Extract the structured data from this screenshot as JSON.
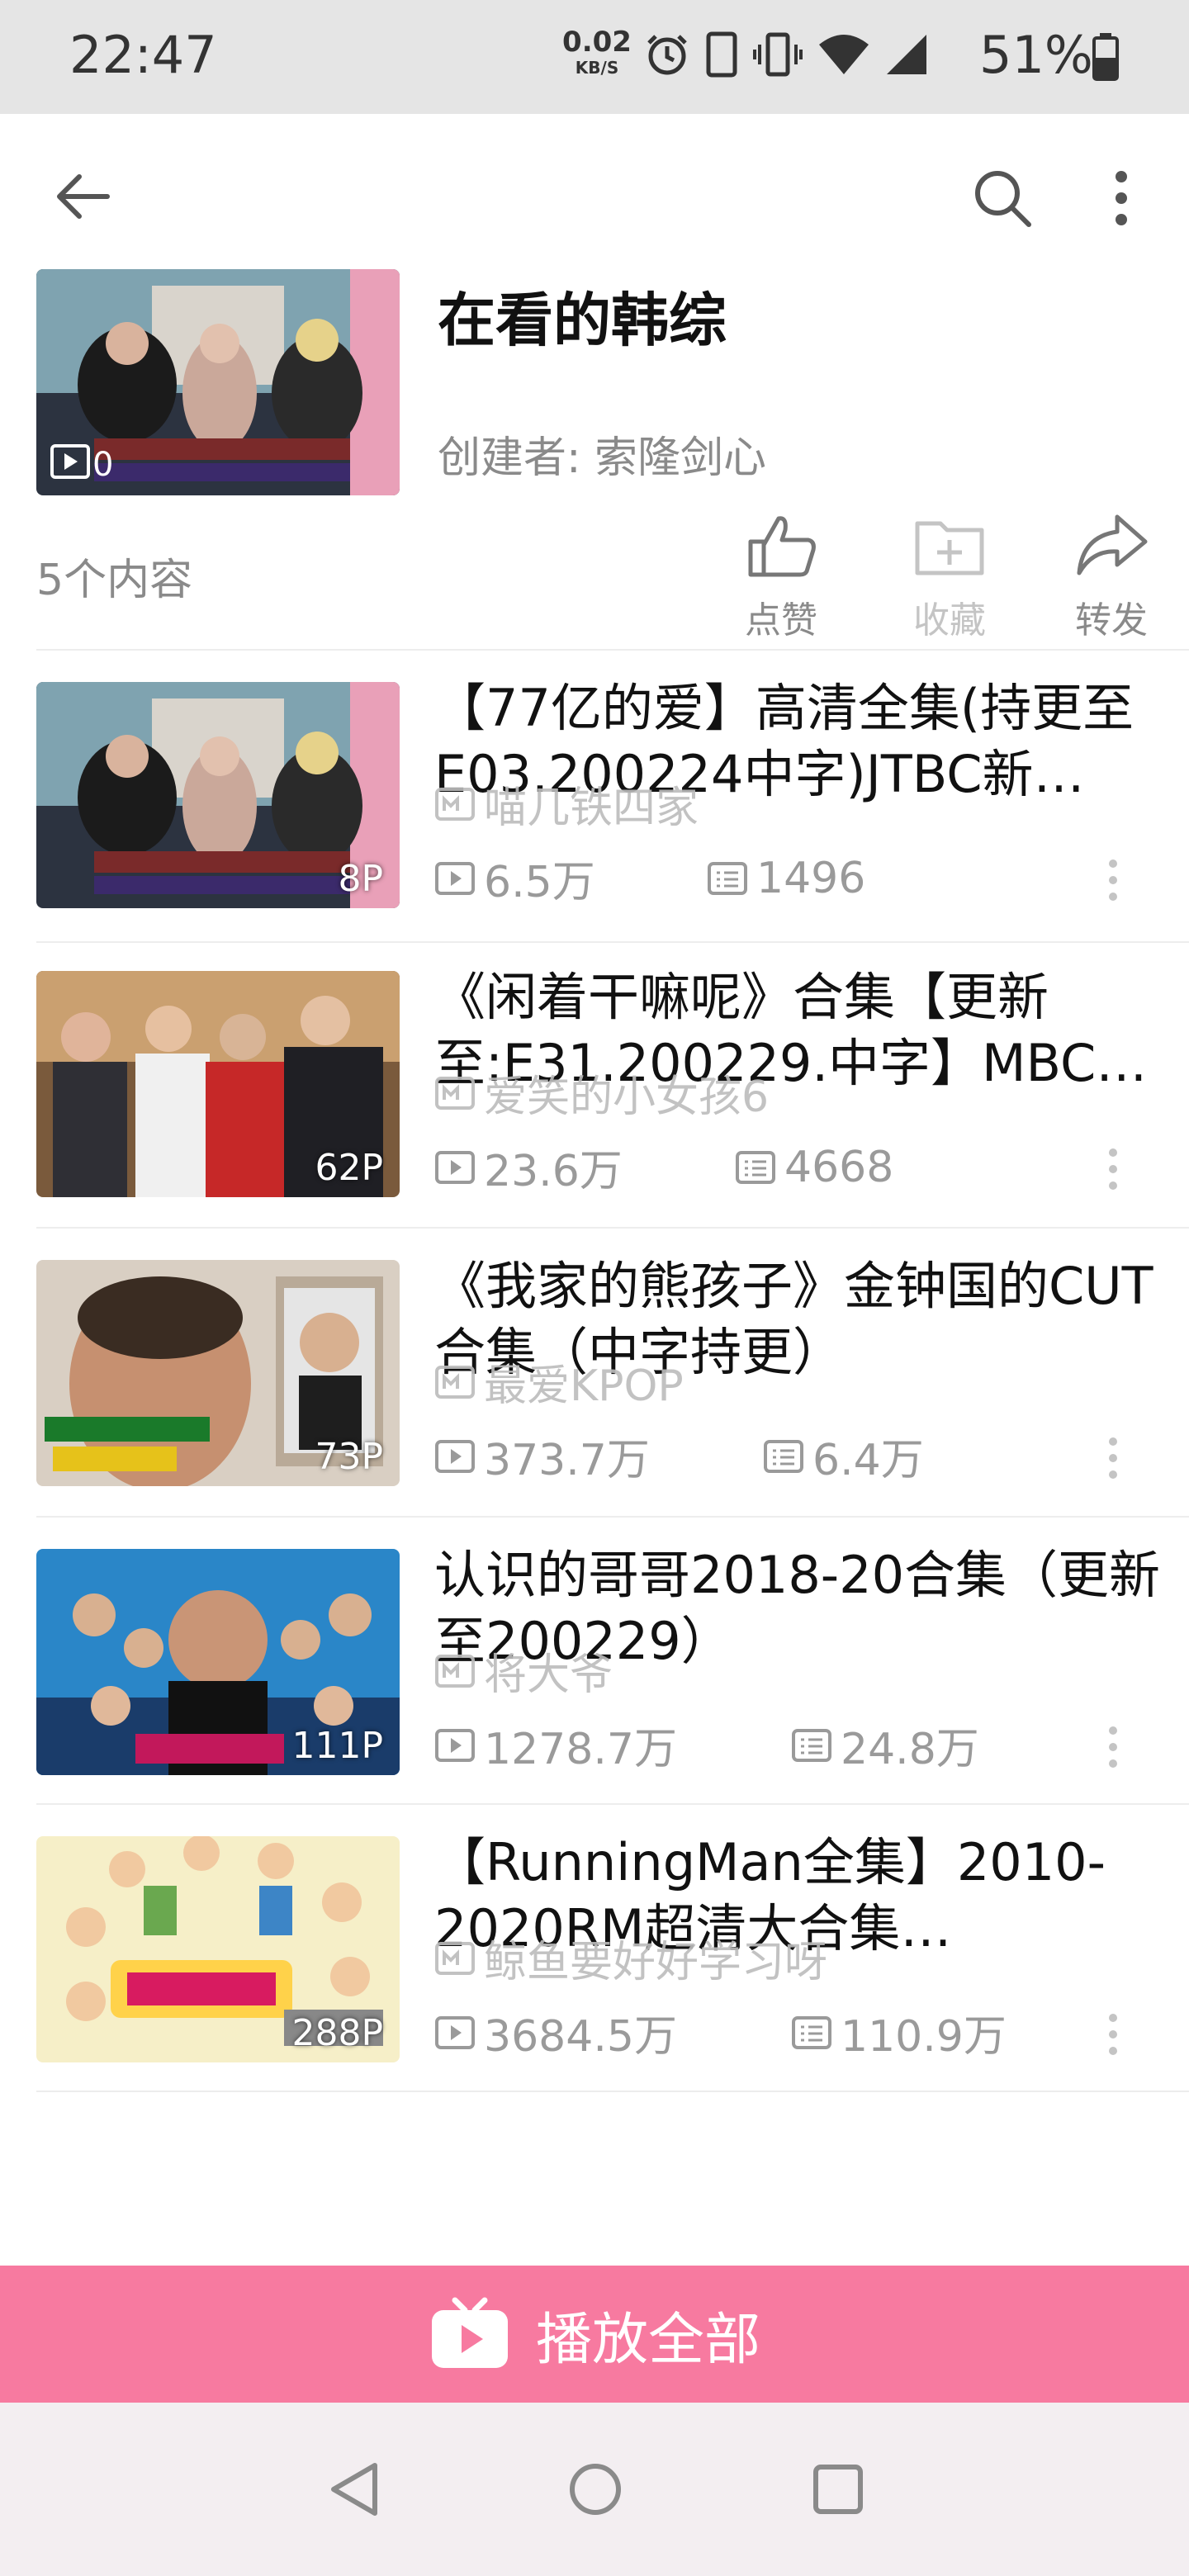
{
  "status_bar": {
    "time": "22:47",
    "net_speed_value": "0.02",
    "net_speed_unit": "KB/S",
    "battery": "51%",
    "icons": [
      "alarm-icon",
      "phone-icon",
      "vibrate-icon",
      "wifi-icon",
      "signal-icon",
      "battery-icon"
    ]
  },
  "header": {
    "title": "在看的韩综",
    "creator": "创建者: 索隆剑心",
    "count": "5个内容",
    "actions": {
      "like": "点赞",
      "collect": "收藏",
      "share": "转发"
    }
  },
  "items": [
    {
      "title": "【77亿的爱】高清全集(持更至E03.200224中字)JTBC新…",
      "uploader": "喵几铁四家",
      "badge": "8P",
      "plays": "6.5万",
      "comments": "1496"
    },
    {
      "title": "《闲着干嘛呢》合集【更新至:E31.200229.中字】MBC…",
      "uploader": "爱笑的小女孩6",
      "badge": "62P",
      "plays": "23.6万",
      "comments": "4668"
    },
    {
      "title": "《我家的熊孩子》金钟国的CUT合集（中字持更）",
      "uploader": "最爱KPOP",
      "badge": "73P",
      "plays": "373.7万",
      "comments": "6.4万"
    },
    {
      "title": "认识的哥哥2018-20合集（更新至200229）",
      "uploader": "将大爷",
      "badge": "111P",
      "plays": "1278.7万",
      "comments": "24.8万"
    },
    {
      "title": "【RunningMan全集】2010-2020RM超清大合集…",
      "uploader": "鲸鱼要好好学习呀",
      "badge": "288P",
      "plays": "3684.5万",
      "comments": "110.9万"
    }
  ],
  "play_all_label": "播放全部",
  "colors": {
    "accent_pink": "#f77aa0",
    "status_bar_bg": "#e5e5e5",
    "nav_bar_bg": "#f3eef1",
    "secondary_text": "#8a8a8a"
  }
}
